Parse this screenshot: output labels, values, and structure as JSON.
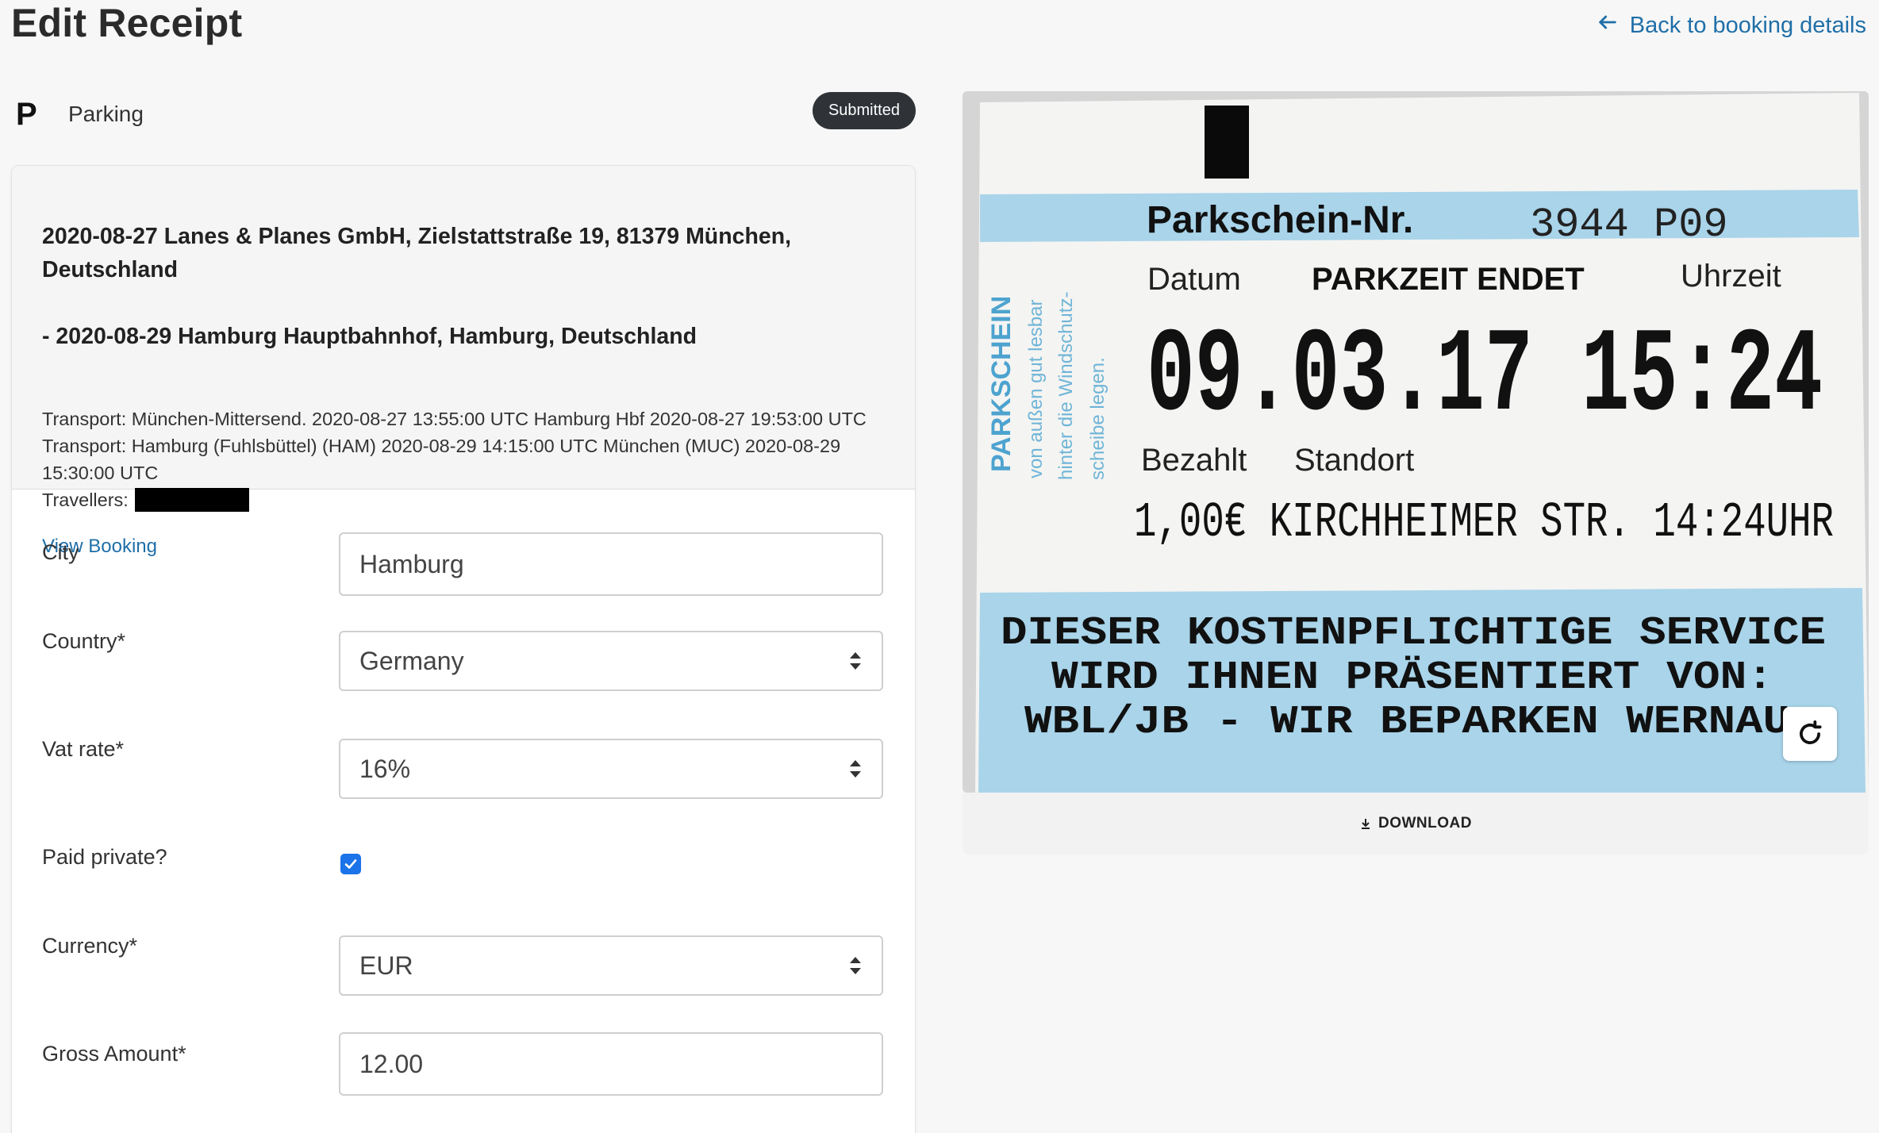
{
  "header": {
    "title": "Edit Receipt",
    "back_link": "Back to booking details"
  },
  "category": {
    "icon_letter": "P",
    "label": "Parking",
    "status": "Submitted"
  },
  "booking": {
    "route_line1": "2020-08-27 Lanes & Planes GmbH, Zielstattstraße 19, 81379 München, Deutschland",
    "route_line2": "- 2020-08-29 Hamburg Hauptbahnhof, Hamburg, Deutschland",
    "transport": "Transport: München-Mittersend. 2020-08-27 13:55:00 UTC Hamburg Hbf 2020-08-27 19:53:00 UTC Transport: Hamburg (Fuhlsbüttel) (HAM) 2020-08-29 14:15:00 UTC München (MUC) 2020-08-29 15:30:00 UTC",
    "travellers_label": "Travellers:",
    "view_booking": "View Booking"
  },
  "form": {
    "city_label": "City",
    "city_value": "Hamburg",
    "country_label": "Country*",
    "country_value": "Germany",
    "vat_label": "Vat rate*",
    "vat_value": "16%",
    "paid_private_label": "Paid private?",
    "paid_private_checked": true,
    "currency_label": "Currency*",
    "currency_value": "EUR",
    "gross_label": "Gross Amount*",
    "gross_value": "12.00"
  },
  "receipt": {
    "ticket_title": "Parkschein-Nr.",
    "ticket_number": "3944  P09",
    "label_datum": "Datum",
    "label_parkzeit": "PARKZEIT ENDET",
    "label_uhrzeit": "Uhrzeit",
    "datetime": "09.03.17 15:24",
    "label_bezahlt": "Bezahlt",
    "label_standort": "Standort",
    "paid_line": "1,00€ KIRCHHEIMER STR.  14:24UHR",
    "side_title": "PARKSCHEIN",
    "side_text1": "von außen gut lesbar",
    "side_text2": "hinter die Windschutz-",
    "side_text3": "scheibe legen.",
    "footer_line1": "DIESER KOSTENPFLICHTIGE SERVICE",
    "footer_line2": "WIRD IHNEN PRÄSENTIERT VON:",
    "footer_line3": "WBL/JB - WIR BEPARKEN WERNAU",
    "download_label": "DOWNLOAD"
  },
  "colors": {
    "link": "#1f6fa8",
    "badge_bg": "#2f3338",
    "checkbox": "#1a73e8",
    "ticket_blue": "#a9d4ea"
  },
  "icons": [
    "arrow-left-icon",
    "parking-icon",
    "select-arrows-icon",
    "checkmark-icon",
    "rotate-icon",
    "download-icon"
  ]
}
